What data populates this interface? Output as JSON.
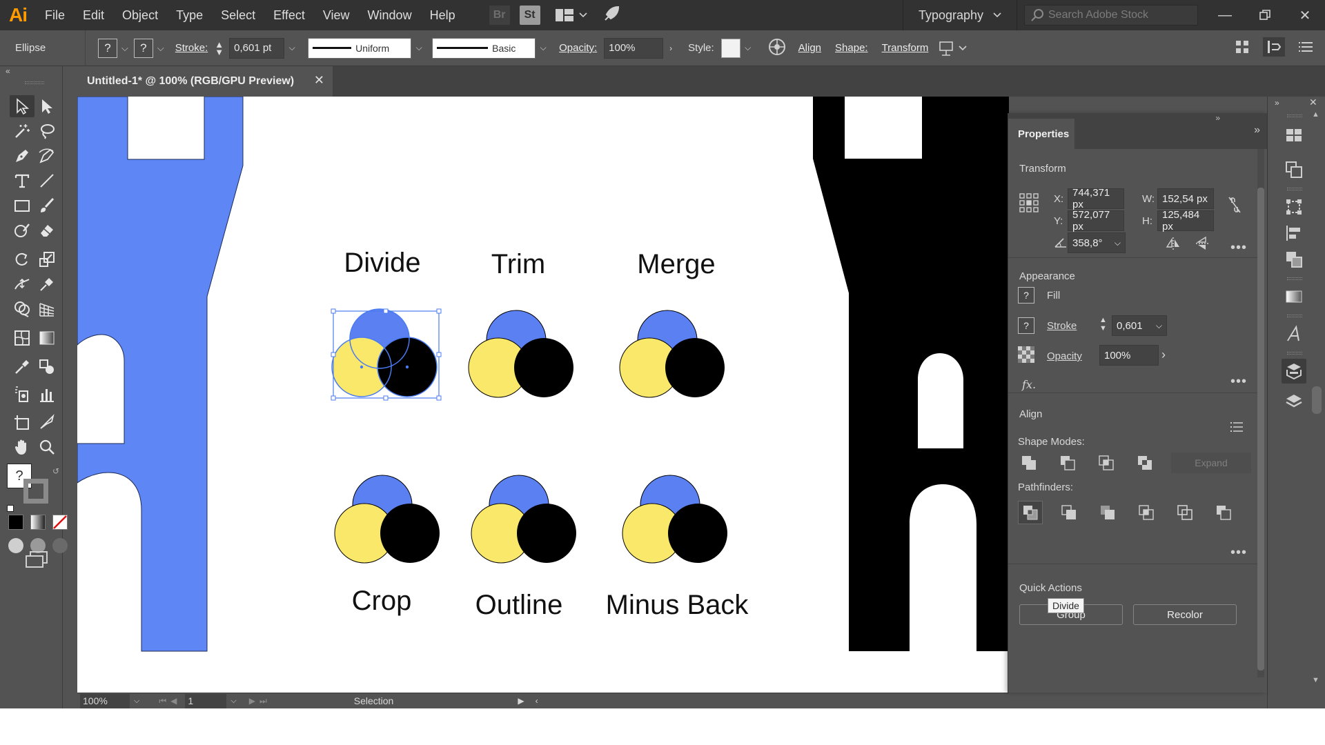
{
  "app": {
    "logo": "Ai",
    "menu": [
      "File",
      "Edit",
      "Object",
      "Type",
      "Select",
      "Effect",
      "View",
      "Window",
      "Help"
    ],
    "bridge_icon": "Br",
    "stock_icon": "St",
    "workspace": "Typography",
    "search_placeholder": "Search Adobe Stock"
  },
  "control_bar": {
    "selection_type": "Ellipse",
    "fill_swatch": "?",
    "stroke_swatch": "?",
    "stroke_label": "Stroke:",
    "stroke_value": "0,601 pt",
    "variable_width": "Uniform",
    "brush": "Basic",
    "opacity_label": "Opacity:",
    "opacity_value": "100%",
    "style_label": "Style:",
    "align_label": "Align",
    "shape_label": "Shape:",
    "transform_label": "Transform"
  },
  "document": {
    "tab_title": "Untitled-1* @ 100% (RGB/GPU Preview)"
  },
  "canvas": {
    "labels": {
      "divide": "Divide",
      "trim": "Trim",
      "merge": "Merge",
      "crop": "Crop",
      "outline": "Outline",
      "minus_back": "Minus Back"
    },
    "colors": {
      "blue": "#5b80f2",
      "yellow": "#fae86a",
      "black": "#000000",
      "castle_blue": "#5f86f5",
      "selection": "#4a7bf0"
    }
  },
  "status_bar": {
    "zoom": "100%",
    "artboard": "1",
    "tool": "Selection"
  },
  "properties": {
    "tab": "Properties",
    "transform": {
      "title": "Transform",
      "x_label": "X:",
      "x": "744,371 px",
      "y_label": "Y:",
      "y": "572,077 px",
      "w_label": "W:",
      "w": "152,54 px",
      "h_label": "H:",
      "h": "125,484 px",
      "angle": "358,8°"
    },
    "appearance": {
      "title": "Appearance",
      "fill_label": "Fill",
      "stroke_label": "Stroke",
      "stroke_value": "0,601",
      "opacity_label": "Opacity",
      "opacity_value": "100%",
      "fx": "fx."
    },
    "align": {
      "title": "Align",
      "shape_modes_label": "Shape Modes:",
      "expand_label": "Expand",
      "pathfinders_label": "Pathfinders:",
      "tooltip": "Divide"
    },
    "quick_actions": {
      "title": "Quick Actions",
      "group_label": "Group",
      "recolor_label": "Recolor"
    }
  }
}
